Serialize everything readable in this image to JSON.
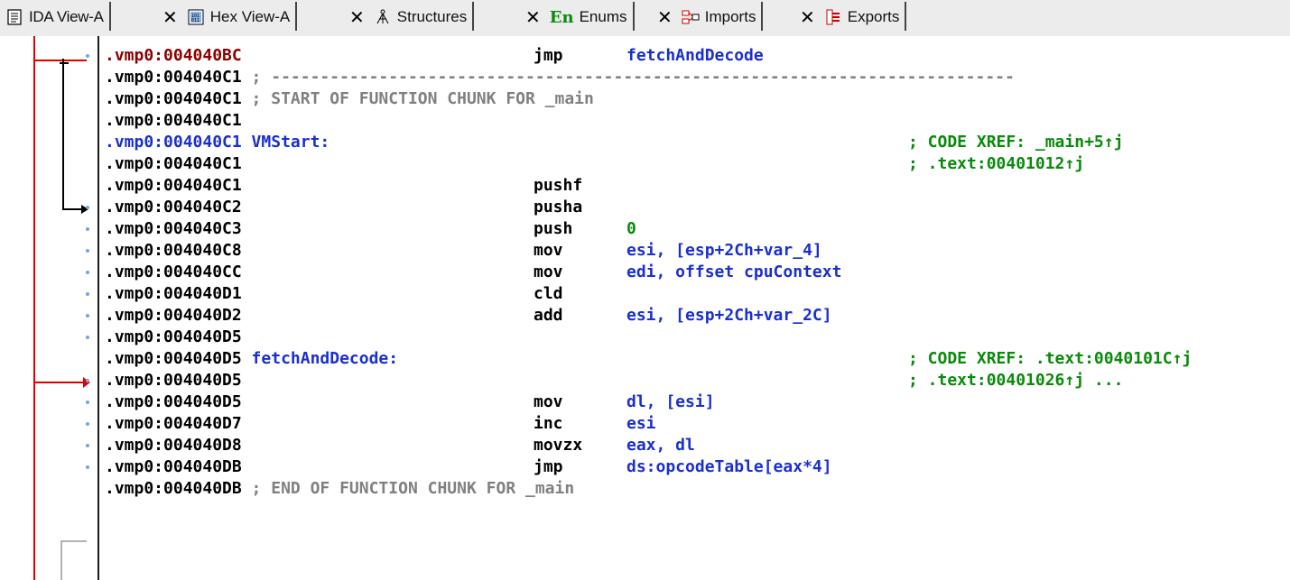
{
  "tabs": [
    {
      "label": "IDA View-A",
      "icon": "document-icon",
      "active": true
    },
    {
      "label": "Hex View-A",
      "icon": "hex-grid-icon",
      "active": false
    },
    {
      "label": "Structures",
      "icon": "tree-structure-icon",
      "active": false
    },
    {
      "label": "Enums",
      "icon": "en-icon",
      "active": false,
      "icon_text": "En"
    },
    {
      "label": "Imports",
      "icon": "imports-icon",
      "active": false
    },
    {
      "label": "Exports",
      "icon": "exports-icon",
      "active": false
    }
  ],
  "close_glyph": "✕",
  "colors": {
    "address_highlight": "#8b0000",
    "label": "#1a2fcf",
    "comment": "#808080",
    "xref": "#0a8a0a",
    "flow_arrow_red": "#e00000",
    "flow_arrow_black": "#000000",
    "bullet": "#6fa8dc"
  },
  "lines": [
    {
      "addr": ".vmp0:004040BC",
      "addr_style": "red",
      "mnemonic": "jmp",
      "operand": "fetchAndDecode"
    },
    {
      "addr": ".vmp0:004040C1",
      "comment": " ; ----------------------------------------------------------------------------"
    },
    {
      "addr": ".vmp0:004040C1",
      "comment": " ; START OF FUNCTION CHUNK FOR _main"
    },
    {
      "addr": ".vmp0:004040C1"
    },
    {
      "addr": ".vmp0:004040C1",
      "addr_style": "blue",
      "label": " VMStart:",
      "xref": "; CODE XREF: _main+5↑j"
    },
    {
      "addr": ".vmp0:004040C1",
      "xref": "; .text:00401012↑j"
    },
    {
      "addr": ".vmp0:004040C1",
      "mnemonic": "pushf"
    },
    {
      "addr": ".vmp0:004040C2",
      "mnemonic": "pusha"
    },
    {
      "addr": ".vmp0:004040C3",
      "mnemonic": "push",
      "operand": "0",
      "operand_style": "green"
    },
    {
      "addr": ".vmp0:004040C8",
      "mnemonic": "mov",
      "operand": "esi, [esp+2Ch+var_4]"
    },
    {
      "addr": ".vmp0:004040CC",
      "mnemonic": "mov",
      "operand": "edi, offset cpuContext"
    },
    {
      "addr": ".vmp0:004040D1",
      "mnemonic": "cld"
    },
    {
      "addr": ".vmp0:004040D2",
      "mnemonic": "add",
      "operand": "esi, [esp+2Ch+var_2C]"
    },
    {
      "addr": ".vmp0:004040D5"
    },
    {
      "addr": ".vmp0:004040D5",
      "label": " fetchAndDecode:",
      "xref": "; CODE XREF: .text:0040101C↑j"
    },
    {
      "addr": ".vmp0:004040D5",
      "xref": "; .text:00401026↑j ..."
    },
    {
      "addr": ".vmp0:004040D5",
      "mnemonic": "mov",
      "operand": "dl, [esi]"
    },
    {
      "addr": ".vmp0:004040D7",
      "mnemonic": "inc",
      "operand": "esi"
    },
    {
      "addr": ".vmp0:004040D8",
      "mnemonic": "movzx",
      "operand": "eax, dl"
    },
    {
      "addr": ".vmp0:004040DB",
      "mnemonic": "jmp",
      "operand": "ds:opcodeTable[eax*4]"
    },
    {
      "addr": ".vmp0:004040DB",
      "comment": " ; END OF FUNCTION CHUNK FOR _main"
    }
  ]
}
